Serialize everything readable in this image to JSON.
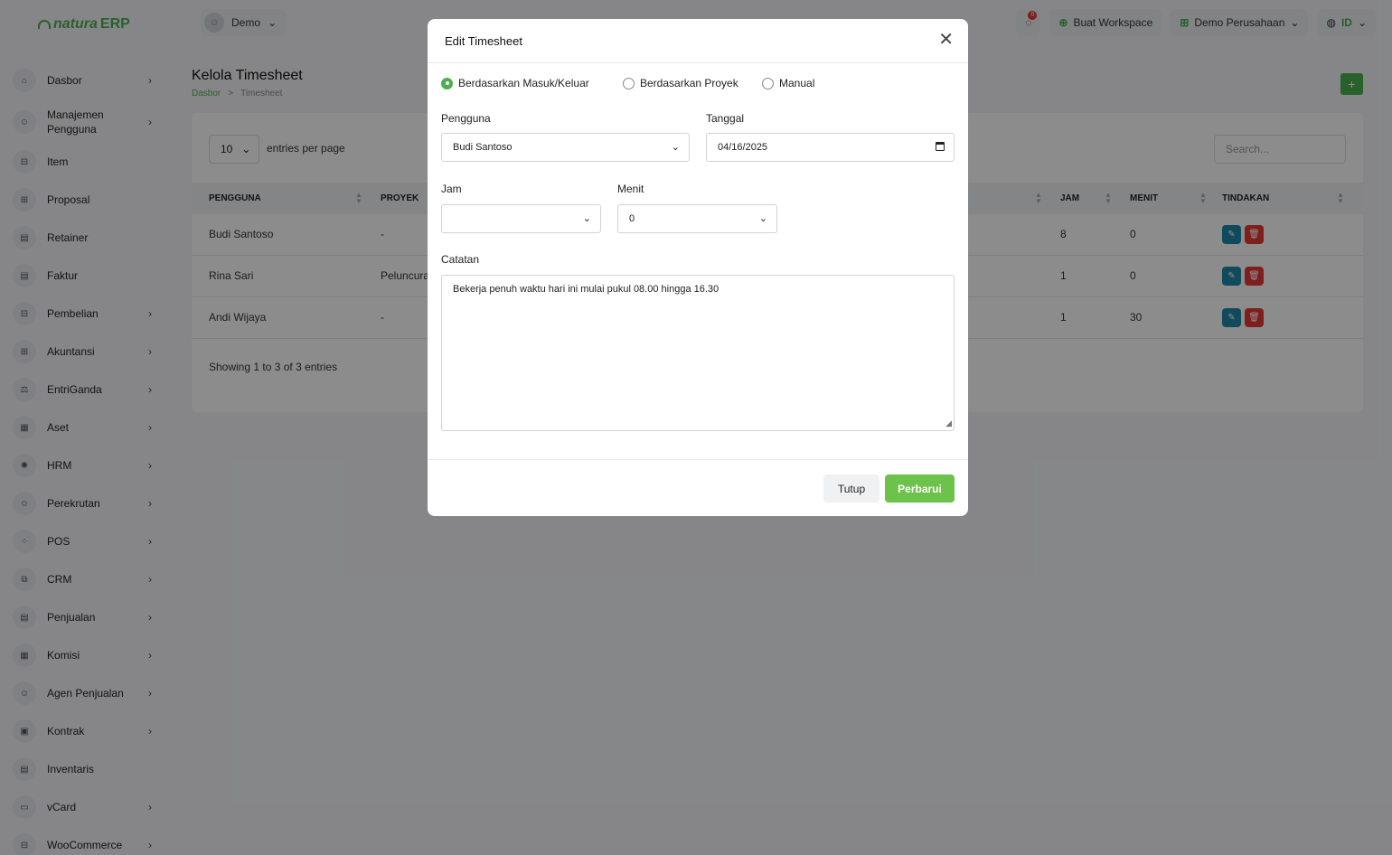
{
  "app": {
    "logo_text_a": "natura",
    "logo_text_b": "ERP"
  },
  "topbar": {
    "user_label": "Demo",
    "notif_count": "0",
    "workspace_label": "Buat Workspace",
    "company_label": "Demo Perusahaan",
    "lang_label": "ID"
  },
  "sidebar": {
    "items": [
      {
        "label": "Dasbor",
        "icon": "home-icon",
        "chevron": true
      },
      {
        "label": "Manajemen Pengguna",
        "icon": "users-icon",
        "chevron": true
      },
      {
        "label": "Item",
        "icon": "cart-icon",
        "chevron": false
      },
      {
        "label": "Proposal",
        "icon": "proposal-icon",
        "chevron": false
      },
      {
        "label": "Retainer",
        "icon": "retainer-icon",
        "chevron": false
      },
      {
        "label": "Faktur",
        "icon": "invoice-icon",
        "chevron": false
      },
      {
        "label": "Pembelian",
        "icon": "cart-icon",
        "chevron": true
      },
      {
        "label": "Akuntansi",
        "icon": "grid-icon",
        "chevron": true
      },
      {
        "label": "EntriGanda",
        "icon": "scale-icon",
        "chevron": true
      },
      {
        "label": "Aset",
        "icon": "calculator-icon",
        "chevron": true
      },
      {
        "label": "HRM",
        "icon": "hrm-icon",
        "chevron": true
      },
      {
        "label": "Perekrutan",
        "icon": "user-plus-icon",
        "chevron": true
      },
      {
        "label": "POS",
        "icon": "dots-grid-icon",
        "chevron": true
      },
      {
        "label": "CRM",
        "icon": "crm-icon",
        "chevron": true
      },
      {
        "label": "Penjualan",
        "icon": "file-icon",
        "chevron": true
      },
      {
        "label": "Komisi",
        "icon": "calculator-icon",
        "chevron": true
      },
      {
        "label": "Agen Penjualan",
        "icon": "user-check-icon",
        "chevron": true
      },
      {
        "label": "Kontrak",
        "icon": "contract-icon",
        "chevron": true
      },
      {
        "label": "Inventaris",
        "icon": "file-icon",
        "chevron": false
      },
      {
        "label": "vCard",
        "icon": "card-icon",
        "chevron": true
      },
      {
        "label": "WooCommerce",
        "icon": "cart-icon",
        "chevron": true
      }
    ]
  },
  "page": {
    "title": "Kelola Timesheet",
    "breadcrumb_home": "Dasbor",
    "breadcrumb_sep": ">",
    "breadcrumb_current": "Timesheet",
    "add_label": "+"
  },
  "table": {
    "per_page_value": "10",
    "per_page_label": "entries per page",
    "search_placeholder": "Search...",
    "headers": {
      "user": "PENGGUNA",
      "project": "PROYEK",
      "hours": "JAM",
      "minutes": "MENIT",
      "actions": "TINDAKAN"
    },
    "rows": [
      {
        "user": "Budi Santoso",
        "project": "-",
        "hours": "8",
        "minutes": "0"
      },
      {
        "user": "Rina Sari",
        "project": "Peluncuran",
        "hours": "1",
        "minutes": "0"
      },
      {
        "user": "Andi Wijaya",
        "project": "-",
        "hours": "1",
        "minutes": "30"
      }
    ],
    "showing": "Showing 1 to 3 of 3 entries"
  },
  "modal": {
    "title": "Edit Timesheet",
    "radios": [
      {
        "label": "Berdasarkan Masuk/Keluar",
        "checked": true
      },
      {
        "label": "Berdasarkan Proyek",
        "checked": false
      },
      {
        "label": "Manual",
        "checked": false
      }
    ],
    "user_label": "Pengguna",
    "user_value": "Budi Santoso",
    "date_label": "Tanggal",
    "date_value": "04/16/2025",
    "hours_label": "Jam",
    "hours_value": "",
    "minutes_label": "Menit",
    "minutes_value": "0",
    "notes_label": "Catatan",
    "notes_value": "Bekerja penuh waktu hari ini mulai pukul 08.00 hingga 16.30",
    "close_label": "Tutup",
    "update_label": "Perbarui"
  },
  "colors": {
    "brand": "#4caf50",
    "update_button": "#6cc24a",
    "edit_action": "#1e88a8",
    "delete_action": "#e53935"
  }
}
